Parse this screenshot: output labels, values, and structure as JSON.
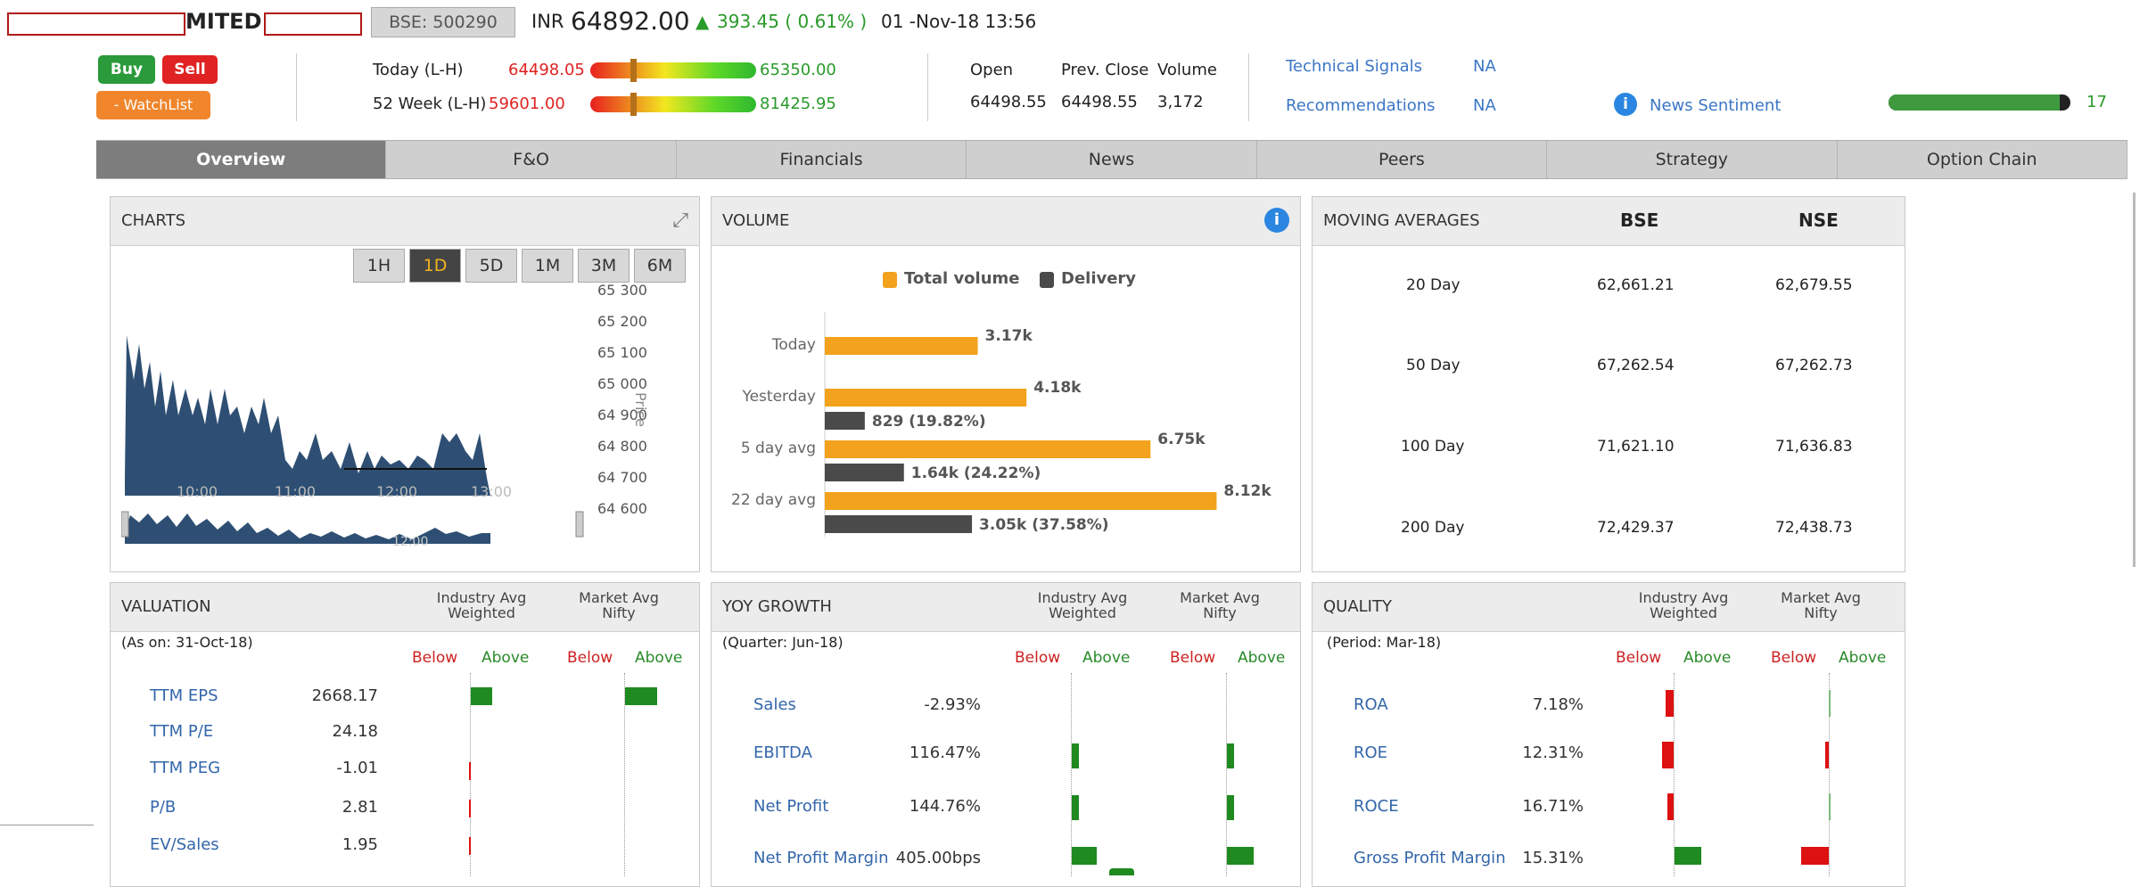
{
  "header": {
    "company": "MITED",
    "exchange": "BSE: 500290",
    "currency": "INR",
    "price": "64892.00",
    "change_arrow": "▲",
    "change": "393.45 ( 0.61% )",
    "datetime": "01 -Nov-18 13:56"
  },
  "actions": {
    "buy": "Buy",
    "sell": "Sell",
    "watchlist": "- WatchList"
  },
  "ranges": {
    "today_label": "Today (L-H)",
    "today_low": "64498.05",
    "today_high": "65350.00",
    "today_level": 0.24,
    "week52_label": "52 Week (L-H)",
    "week52_low": "59601.00",
    "week52_high": "81425.95",
    "week52_level": 0.24
  },
  "quote": {
    "open_label": "Open",
    "prev_label": "Prev. Close",
    "volume_label": "Volume",
    "open": "64498.55",
    "prev": "64498.55",
    "volume": "3,172"
  },
  "signals": {
    "tech_label": "Technical Signals",
    "tech_value": "NA",
    "rec_label": "Recommendations",
    "rec_value": "NA",
    "news_label": "News Sentiment",
    "news_value": "17",
    "news_level": 0.94
  },
  "tabs": [
    "Overview",
    "F&O",
    "Financials",
    "News",
    "Peers",
    "Strategy",
    "Option Chain"
  ],
  "charts": {
    "title": "CHARTS",
    "ranges": [
      "1H",
      "1D",
      "5D",
      "1M",
      "3M",
      "6M"
    ],
    "active": "1D",
    "y_ticks": [
      "65 300",
      "65 200",
      "65 100",
      "65 000",
      "64 900",
      "64 800",
      "64 700",
      "64 600"
    ],
    "x_ticks": [
      "10:00",
      "11:00",
      "12:00",
      "13:00"
    ],
    "nav_tick": "12:00",
    "ylabel": "Price"
  },
  "volume": {
    "title": "VOLUME",
    "legend_total": "Total volume",
    "legend_delivery": "Delivery"
  },
  "chart_data": {
    "type": "bar",
    "categories": [
      "Today",
      "Yesterday",
      "5 day avg",
      "22 day avg"
    ],
    "series": [
      {
        "name": "Total volume",
        "values": [
          3170,
          4180,
          6750,
          8120
        ],
        "labels": [
          "3.17k",
          "4.18k",
          "6.75k",
          "8.12k"
        ],
        "color": "#f2a21c"
      },
      {
        "name": "Delivery",
        "values": [
          0,
          829,
          1640,
          3050
        ],
        "labels": [
          "",
          "829 (19.82%)",
          "1.64k (24.22%)",
          "3.05k (37.58%)"
        ],
        "color": "#4a4a4a"
      }
    ],
    "xlim": [
      0,
      8500
    ]
  },
  "ma": {
    "title": "MOVING AVERAGES",
    "bse": "BSE",
    "nse": "NSE",
    "rows": [
      {
        "label": "20 Day",
        "bse": "62,661.21",
        "nse": "62,679.55"
      },
      {
        "label": "50 Day",
        "bse": "67,262.54",
        "nse": "67,262.73"
      },
      {
        "label": "100 Day",
        "bse": "71,621.10",
        "nse": "71,636.83"
      },
      {
        "label": "200 Day",
        "bse": "72,429.37",
        "nse": "72,438.73"
      }
    ]
  },
  "cols": {
    "ind1": "Industry Avg",
    "ind2": "Weighted",
    "mkt1": "Market Avg",
    "mkt2": "Nifty",
    "below": "Below",
    "above": "Above"
  },
  "valuation": {
    "title": "VALUATION",
    "asof": "(As on: 31-Oct-18)",
    "rows": [
      {
        "label": "TTM EPS",
        "value": "2668.17"
      },
      {
        "label": "TTM P/E",
        "value": "24.18"
      },
      {
        "label": "TTM PEG",
        "value": "-1.01"
      },
      {
        "label": "P/B",
        "value": "2.81"
      },
      {
        "label": "EV/Sales",
        "value": "1.95"
      }
    ]
  },
  "yoy": {
    "title": "YOY GROWTH",
    "asof": "(Quarter: Jun-18)",
    "rows": [
      {
        "label": "Sales",
        "value": "-2.93%"
      },
      {
        "label": "EBITDA",
        "value": "116.47%"
      },
      {
        "label": "Net Profit",
        "value": "144.76%"
      },
      {
        "label": "Net Profit Margin",
        "value": "405.00bps"
      }
    ]
  },
  "quality": {
    "title": "QUALITY",
    "asof": "(Period: Mar-18)",
    "rows": [
      {
        "label": "ROA",
        "value": "7.18%"
      },
      {
        "label": "ROE",
        "value": "12.31%"
      },
      {
        "label": "ROCE",
        "value": "16.71%"
      },
      {
        "label": "Gross Profit Margin",
        "value": "15.31%"
      }
    ]
  }
}
